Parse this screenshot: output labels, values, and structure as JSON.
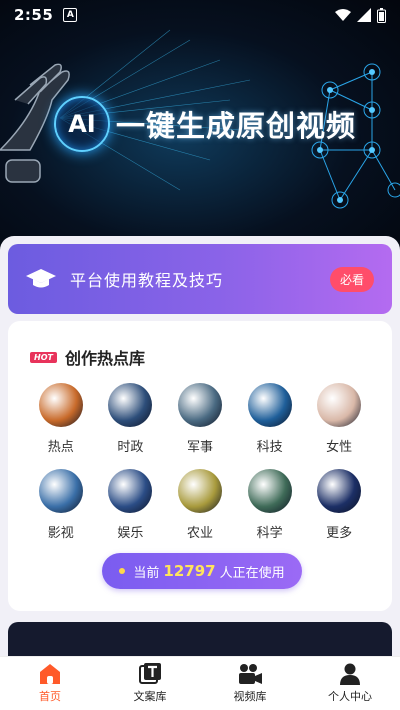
{
  "status": {
    "time": "2:55",
    "badge": "A"
  },
  "hero": {
    "ai_label": "AI",
    "title": "一键生成原创视频"
  },
  "banner": {
    "label": "平台使用教程及技巧",
    "button": "必看"
  },
  "hot": {
    "badge": "HOT",
    "title": "创作热点库",
    "categories": [
      {
        "label": "热点",
        "icon": "fire-icon",
        "color": "#c86a2a"
      },
      {
        "label": "时政",
        "icon": "satellite-icon",
        "color": "#2d4e7a"
      },
      {
        "label": "军事",
        "icon": "jet-icon",
        "color": "#4a6a82"
      },
      {
        "label": "科技",
        "icon": "tech-icon",
        "color": "#1f5f9a"
      },
      {
        "label": "女性",
        "icon": "woman-icon",
        "color": "#d9b8a8"
      },
      {
        "label": "影视",
        "icon": "film-icon",
        "color": "#3a6fa8"
      },
      {
        "label": "娱乐",
        "icon": "microphone-icon",
        "color": "#2b4d86"
      },
      {
        "label": "农业",
        "icon": "wheat-icon",
        "color": "#a89a3c"
      },
      {
        "label": "科学",
        "icon": "leaf-icon",
        "color": "#3f6b58"
      },
      {
        "label": "更多",
        "icon": "galaxy-icon",
        "color": "#1c2f66"
      }
    ]
  },
  "usage": {
    "prefix": "当前",
    "count": "12797",
    "suffix": "人正在使用"
  },
  "tabs": [
    {
      "label": "首页",
      "icon": "home-icon",
      "active": true
    },
    {
      "label": "文案库",
      "icon": "text-doc-icon",
      "active": false
    },
    {
      "label": "视频库",
      "icon": "video-camera-icon",
      "active": false
    },
    {
      "label": "个人中心",
      "icon": "user-icon",
      "active": false
    }
  ],
  "colors": {
    "accent": "#7a5cf0",
    "hot": "#e8335b",
    "active_tab": "#ff5a2a"
  }
}
